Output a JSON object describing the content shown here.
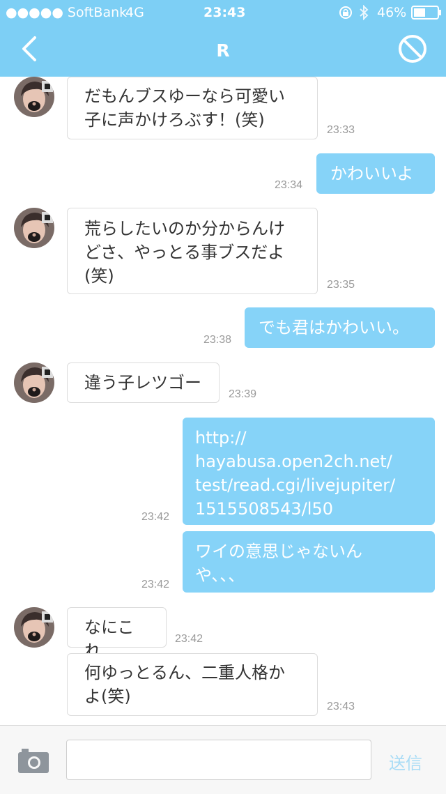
{
  "status_bar": {
    "carrier": "●●●●● SoftBank",
    "network": "4G",
    "time": "23:43",
    "battery": "46%"
  },
  "nav": {
    "title": "R",
    "back_icon": "chevron-left-icon",
    "block_icon": "block-icon"
  },
  "messages": [
    {
      "side": "in",
      "lines": "だもんブスゆーなら可愛い\n子に声かけろぶす！(笑)",
      "time": "23:33"
    },
    {
      "side": "out",
      "lines": "かわいいよ",
      "time": "23:34"
    },
    {
      "side": "in",
      "lines": "荒らしたいのか分からんけ\nどさ、やっとる事ブスだよ\n(笑)",
      "time": "23:35"
    },
    {
      "side": "out",
      "lines": "でも君はかわいい。",
      "time": "23:38"
    },
    {
      "side": "in",
      "lines": "違う子レツゴー",
      "time": "23:39"
    },
    {
      "side": "out",
      "lines": "http://\nhayabusa.open2ch.net/\ntest/read.cgi/livejupiter/\n1515508543/l50",
      "time": "23:42"
    },
    {
      "side": "out",
      "lines": "ワイの意思じゃないん\nや、、、",
      "time": "23:42"
    },
    {
      "side": "in",
      "lines": "なにこれ",
      "time": "23:42"
    },
    {
      "side": "in",
      "lines": "何ゆっとるん、二重人格か\nよ(笑)",
      "time": "23:43"
    }
  ],
  "composer": {
    "camera_icon": "camera-icon",
    "input_value": "",
    "send_label": "送信"
  },
  "colors": {
    "header": "#7dcff5",
    "outgoing_bubble": "#86d3f8",
    "send_disabled": "#a9dcf6"
  }
}
